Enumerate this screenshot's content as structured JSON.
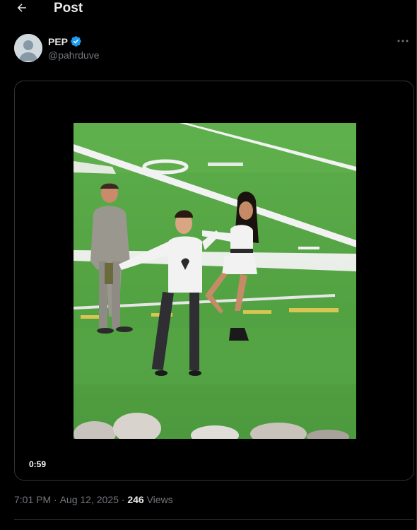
{
  "header": {
    "title": "Post",
    "back_icon": "arrow-left-icon"
  },
  "author": {
    "display_name": "PEP",
    "handle": "@pahrduve",
    "verified_color": "#1d9bf0",
    "avatar_icon": "default-user-avatar-icon"
  },
  "more_icon": "ellipsis-horizontal-icon",
  "media": {
    "type": "video",
    "duration": "0:59"
  },
  "meta": {
    "time": "7:01 PM",
    "date": "Aug 12, 2025",
    "separator": "·",
    "views_count": "246",
    "views_label": "Views"
  },
  "colors": {
    "background": "#000000",
    "text_primary": "#e7e9ea",
    "text_secondary": "#71767b",
    "border": "#2f3336",
    "accent": "#1d9bf0"
  }
}
